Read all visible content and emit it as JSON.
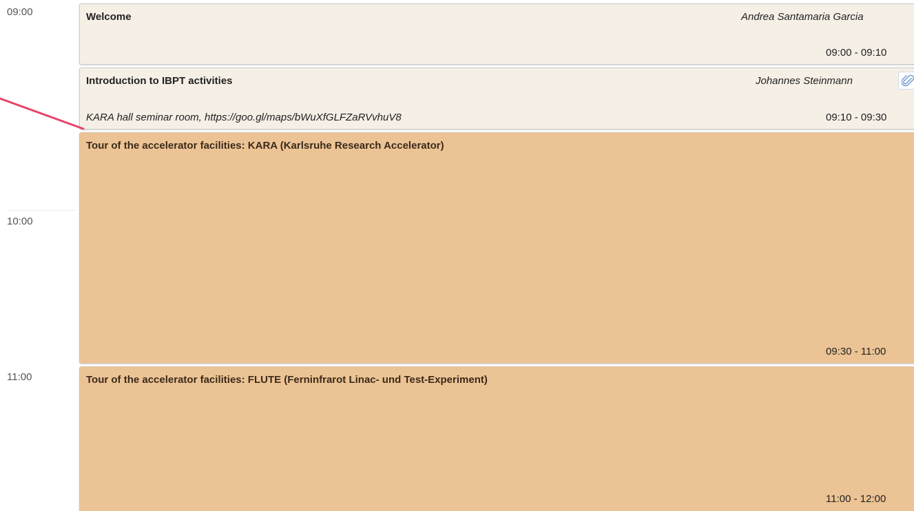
{
  "times": {
    "t0900": "09:00",
    "t1000": "10:00",
    "t1100": "11:00"
  },
  "entries": {
    "welcome": {
      "title": "Welcome",
      "speaker": "Andrea Santamaria Garcia",
      "time": "09:00 - 09:10"
    },
    "intro": {
      "title": "Introduction to IBPT activities",
      "speaker": "Johannes Steinmann",
      "location": "KARA hall seminar room, https://goo.gl/maps/bWuXfGLFZaRVvhuV8",
      "time": "09:10 - 09:30",
      "attachment_icon": "paperclip-icon"
    },
    "tour_kara": {
      "title": "Tour of the accelerator facilities: KARA (Karlsruhe Research Accelerator)",
      "time": "09:30 - 11:00"
    },
    "tour_flute": {
      "title": "Tour of the accelerator facilities: FLUTE (Ferninfrarot Linac- und Test-Experiment)",
      "time": "11:00 - 12:00"
    }
  },
  "colors": {
    "entry_background": "#f5efe6",
    "break_background": "#ecc394",
    "annotation_arrow": "#e8436a",
    "attachment_icon": "#7aa3d4"
  }
}
